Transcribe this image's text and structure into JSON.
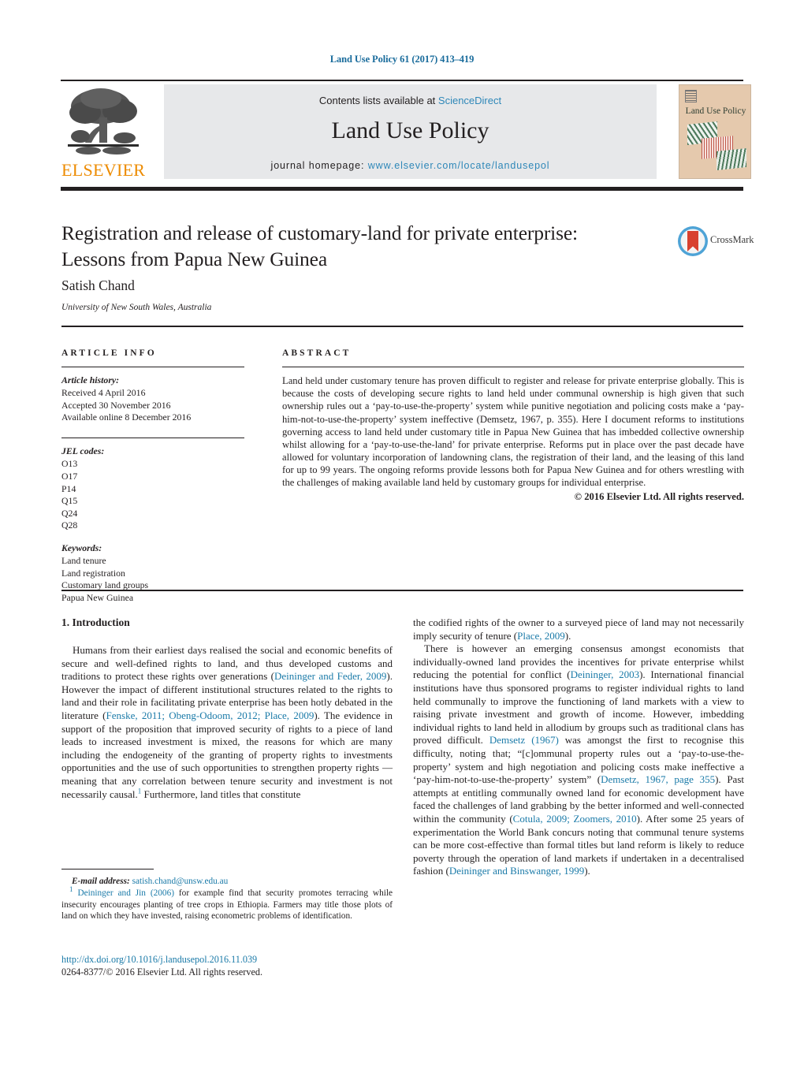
{
  "running_head": "Land Use Policy 61 (2017) 413–419",
  "masthead": {
    "contents_prefix": "Contents lists available at ",
    "contents_link": "ScienceDirect",
    "journal_title": "Land Use Policy",
    "homepage_prefix": "journal homepage: ",
    "homepage_link": "www.elsevier.com/locate/landusepol",
    "publisher_logo_text": "ELSEVIER",
    "cover_title": "Land Use Policy"
  },
  "crossmark": {
    "label": "CrossMark"
  },
  "article": {
    "title_line1": "Registration and release of customary-land for private enterprise:",
    "title_line2": "Lessons from Papua New Guinea",
    "author": "Satish Chand",
    "affiliation": "University of New South Wales, Australia"
  },
  "article_info": {
    "heading": "ARTICLE INFO",
    "history_label": "Article history:",
    "history": [
      "Received 4 April 2016",
      "Accepted 30 November 2016",
      "Available online 8 December 2016"
    ],
    "jel_label": "JEL codes:",
    "jel_codes": [
      "O13",
      "O17",
      "P14",
      "Q15",
      "Q24",
      "Q28"
    ],
    "keywords_label": "Keywords:",
    "keywords": [
      "Land tenure",
      "Land registration",
      "Customary land groups",
      "Papua New Guinea"
    ]
  },
  "abstract": {
    "heading": "ABSTRACT",
    "text": "Land held under customary tenure has proven difficult to register and release for private enterprise globally. This is because the costs of developing secure rights to land held under communal ownership is high given that such ownership rules out a ‘pay-to-use-the-property’ system while punitive negotiation and policing costs make a ‘pay-him-not-to-use-the-property’ system ineffective (Demsetz, 1967, p. 355). Here I document reforms to institutions governing access to land held under customary title in Papua New Guinea that has imbedded collective ownership whilst allowing for a ‘pay-to-use-the-land’ for private enterprise. Reforms put in place over the past decade have allowed for voluntary incorporation of landowning clans, the registration of their land, and the leasing of this land for up to 99 years. The ongoing reforms provide lessons both for Papua New Guinea and for others wrestling with the challenges of making available land held by customary groups for individual enterprise.",
    "copyright": "© 2016 Elsevier Ltd. All rights reserved."
  },
  "body": {
    "section_title": "1. Introduction",
    "left_paragraph_1": {
      "t1": "Humans from their earliest days realised the social and economic benefits of secure and well-defined rights to land, and thus developed customs and traditions to protect these rights over generations (",
      "ref1": "Deininger and Feder, 2009",
      "t2": "). However the impact of different institutional structures related to the rights to land and their role in facilitating private enterprise has been hotly debated in the literature (",
      "ref2": "Fenske, 2011; Obeng-Odoom, 2012; Place, 2009",
      "t3": "). The evidence in support of the proposition that improved security of rights to a piece of land leads to increased investment is mixed, the reasons for which are many including the endogeneity of the granting of property rights to investments opportunities and the use of such opportunities to strengthen property rights — meaning that any correlation between tenure security and investment is not necessarily causal.",
      "fn": "1",
      "t4": " Furthermore, land titles that constitute"
    },
    "right_paragraph_1": {
      "t1": "the codified rights of the owner to a surveyed piece of land may not necessarily imply security of tenure (",
      "ref1": "Place, 2009",
      "t2": ")."
    },
    "right_paragraph_2": {
      "t1": "There is however an emerging consensus amongst economists that individually-owned land provides the incentives for private enterprise whilst reducing the potential for conflict (",
      "ref1": "Deininger, 2003",
      "t2": "). International financial institutions have thus sponsored programs to register individual rights to land held communally to improve the functioning of land markets with a view to raising private investment and growth of income. However, imbedding individual rights to land held in allodium by groups such as traditional clans has proved difficult. ",
      "ref2": "Demsetz (1967)",
      "t3": " was amongst the first to recognise this difficulty, noting that; “[c]ommunal property rules out a ‘pay-to-use-the-property’ system and high negotiation and policing costs make ineffective a ‘pay-him-not-to-use-the-property’ system” (",
      "ref3": "Demsetz, 1967, page 355",
      "t4": "). Past attempts at entitling communally owned land for economic development have faced the challenges of land grabbing by the better informed and well-connected within the community (",
      "ref4": "Cotula, 2009; Zoomers, 2010",
      "t5": "). After some 25 years of experimentation the World Bank concurs noting that communal tenure systems can be more cost-effective than formal titles but land reform is likely to reduce poverty through the operation of land markets if undertaken in a decentralised fashion (",
      "ref5": "Deininger and Binswanger, 1999",
      "t6": ")."
    }
  },
  "footnotes": {
    "email_label": "E-mail address:",
    "email": "satish.chand@unsw.edu.au",
    "marker": "1",
    "ref": "Deininger and Jin (2006)",
    "text": " for example find that security promotes terracing while insecurity encourages planting of tree crops in Ethiopia. Farmers may title those plots of land on which they have invested, raising econometric problems of identification."
  },
  "footer": {
    "doi": "http://dx.doi.org/10.1016/j.landusepol.2016.11.039",
    "issn": "0264-8377/© 2016 Elsevier Ltd. All rights reserved."
  },
  "colors": {
    "link_blue": "#1a7aa8",
    "masthead_link_blue": "#2e87b8",
    "running_head_blue": "#1a6c9c",
    "elsevier_orange": "#ed8b00",
    "masthead_gray": "#e7e8ea",
    "text_black": "#231f20"
  }
}
